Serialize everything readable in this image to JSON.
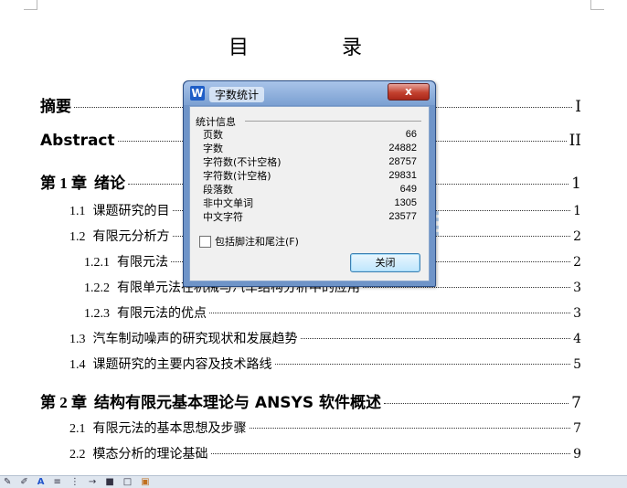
{
  "document": {
    "toc_title": "目　录",
    "entries": [
      {
        "num": "",
        "label": "摘要",
        "page": "I",
        "level": 1
      },
      {
        "num": "",
        "label": "Abstract",
        "page": "II",
        "level": 1
      },
      {
        "num": "第 1 章",
        "label": "绪论",
        "page": "1",
        "level": 1
      },
      {
        "num": "1.1",
        "label": "课题研究的目",
        "page": "1",
        "level": 2
      },
      {
        "num": "1.2",
        "label": "有限元分析方",
        "page": "2",
        "level": 2
      },
      {
        "num": "1.2.1",
        "label": "有限元法",
        "page": "2",
        "level": 3
      },
      {
        "num": "1.2.2",
        "label": "有限单元法在机械与汽车结构分析中的应用",
        "page": "3",
        "level": 3
      },
      {
        "num": "1.2.3",
        "label": "有限元法的优点",
        "page": "3",
        "level": 3
      },
      {
        "num": "1.3",
        "label": "汽车制动噪声的研究现状和发展趋势",
        "page": "4",
        "level": 2
      },
      {
        "num": "1.4",
        "label": "课题研究的主要内容及技术路线",
        "page": "5",
        "level": 2
      },
      {
        "num": "第 2 章",
        "label": "结构有限元基本理论与 ANSYS 软件概述",
        "page": "7",
        "level": 1
      },
      {
        "num": "2.1",
        "label": "有限元法的基本思想及步骤",
        "page": "7",
        "level": 2
      },
      {
        "num": "2.2",
        "label": "模态分析的理论基础",
        "page": "9",
        "level": 2
      }
    ]
  },
  "watermark": {
    "text": "文库",
    "color": "#4a90d9"
  },
  "dialog": {
    "title": "字数统计",
    "app_icon": "W",
    "close_symbol": "x",
    "group_label": "统计信息",
    "stats": [
      {
        "label": "页数",
        "value": "66"
      },
      {
        "label": "字数",
        "value": "24882"
      },
      {
        "label": "字符数(不计空格)",
        "value": "28757"
      },
      {
        "label": "字符数(计空格)",
        "value": "29831"
      },
      {
        "label": "段落数",
        "value": "649"
      },
      {
        "label": "非中文单词",
        "value": "1305"
      },
      {
        "label": "中文字符",
        "value": "23577"
      }
    ],
    "include_footnotes_label": "包括脚注和尾注(F)",
    "include_footnotes_checked": false,
    "close_button_label": "关闭"
  },
  "toolbar": {
    "icons": [
      "paint-icon",
      "pen-icon",
      "font-color-icon",
      "align-icon",
      "list-icon",
      "arrow-icon",
      "shape-icon",
      "box-icon",
      "image-icon"
    ]
  }
}
